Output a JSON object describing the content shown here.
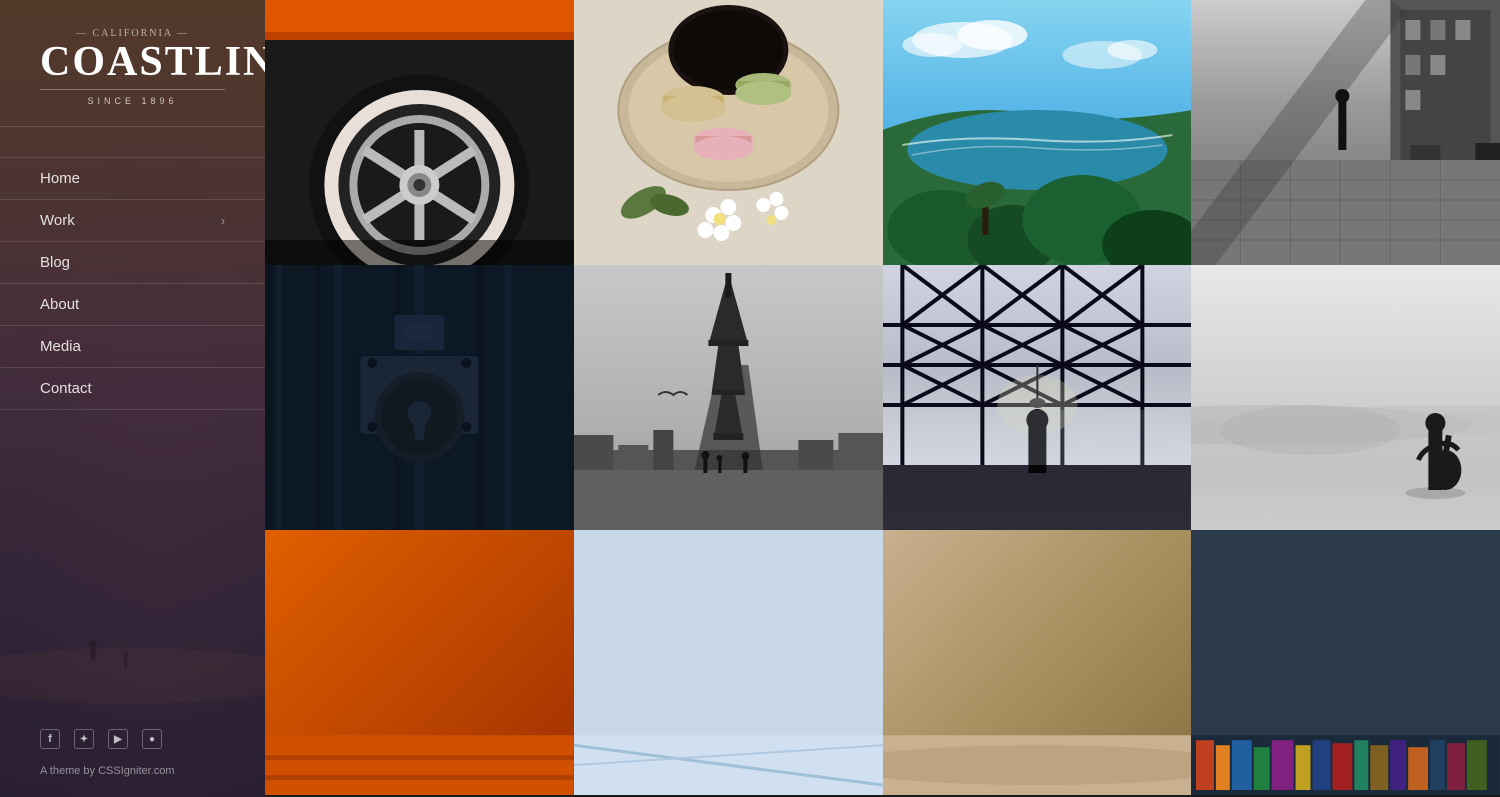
{
  "sidebar": {
    "logo": {
      "dash_line": "- CALIFORNIA -",
      "main": "COASTLINE",
      "since": "SINCE 1896"
    },
    "nav_items": [
      {
        "id": "home",
        "label": "Home",
        "has_arrow": false
      },
      {
        "id": "work",
        "label": "Work",
        "has_arrow": true
      },
      {
        "id": "blog",
        "label": "Blog",
        "has_arrow": false
      },
      {
        "id": "about",
        "label": "About",
        "has_arrow": false
      },
      {
        "id": "media",
        "label": "Media",
        "has_arrow": false
      },
      {
        "id": "contact",
        "label": "Contact",
        "has_arrow": false
      }
    ],
    "social": [
      {
        "id": "facebook",
        "icon": "f",
        "label": "Facebook"
      },
      {
        "id": "twitter",
        "icon": "t",
        "label": "Twitter"
      },
      {
        "id": "youtube",
        "icon": "y",
        "label": "YouTube"
      },
      {
        "id": "dribbble",
        "icon": "d",
        "label": "Dribbble"
      }
    ],
    "footer_text": "A theme by CSSIgniter.com"
  },
  "grid": {
    "cells": [
      {
        "id": "cell-1-1",
        "alt": "Classic car wheel orange"
      },
      {
        "id": "cell-1-2",
        "alt": "Macarons and flowers"
      },
      {
        "id": "cell-1-3",
        "alt": "California coastline"
      },
      {
        "id": "cell-1-4",
        "alt": "Black and white street"
      },
      {
        "id": "cell-2-1",
        "alt": "Blue door lock close-up"
      },
      {
        "id": "cell-2-2",
        "alt": "Eiffel Tower black and white"
      },
      {
        "id": "cell-2-3",
        "alt": "Industrial building silhouette"
      },
      {
        "id": "cell-2-4",
        "alt": "Desert person silhouette"
      },
      {
        "id": "cell-3-1",
        "alt": "Orange car partial"
      },
      {
        "id": "cell-3-2",
        "alt": "Abstract blue geometric"
      },
      {
        "id": "cell-3-3",
        "alt": "Sandy beach tones"
      },
      {
        "id": "cell-3-4",
        "alt": "Colorful shelves"
      }
    ]
  }
}
